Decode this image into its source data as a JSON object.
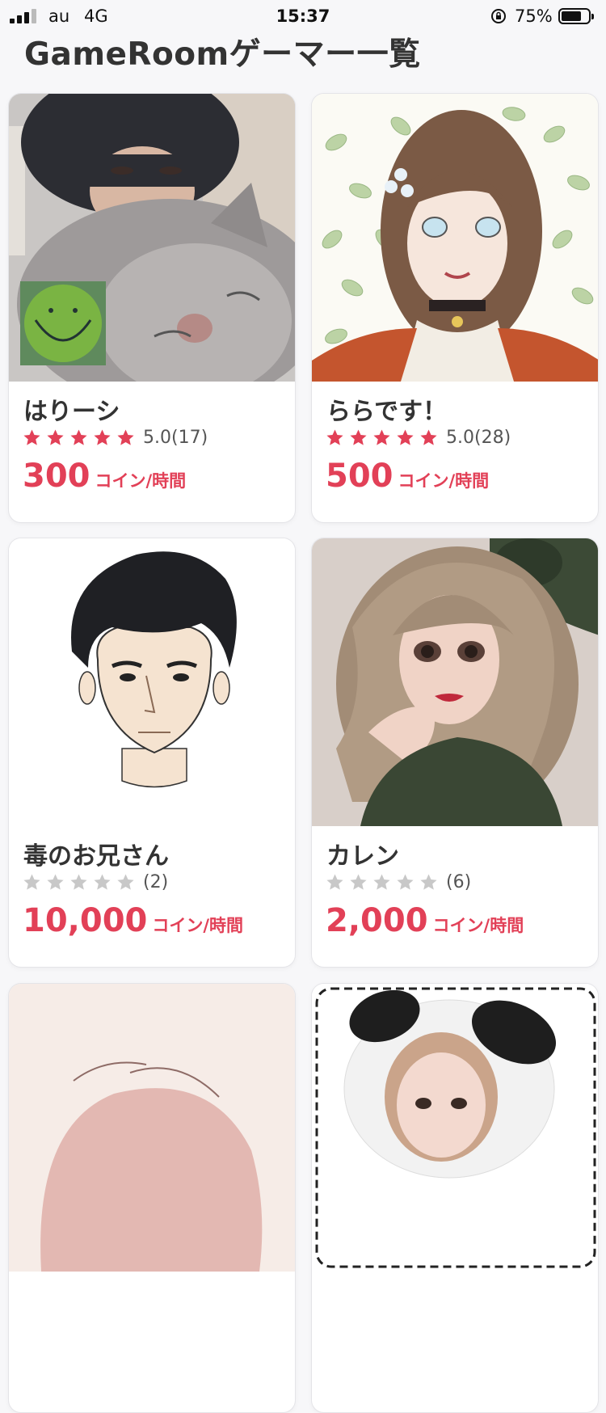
{
  "status_bar": {
    "carrier": "au",
    "network": "4G",
    "time": "15:37",
    "battery_percent": "75%",
    "battery_level": 0.75,
    "signal_bars_filled": 3,
    "signal_bars_total": 4
  },
  "header": {
    "title": "GameRoomゲーマー一覧"
  },
  "colors": {
    "accent": "#e24057",
    "star_filled": "#e24057",
    "star_empty": "#c8c8c8",
    "background": "#f7f7f9"
  },
  "gamers": [
    {
      "name": "はりーシ",
      "rating": 5,
      "rating_text": "5.0(17)",
      "price": "300",
      "unit": "コイン/時間",
      "photo": "man-with-grey-cat-photo"
    },
    {
      "name": "ららです！",
      "rating": 5,
      "rating_text": "5.0(28)",
      "price": "500",
      "unit": "コイン/時間",
      "photo": "illustrated-girl-with-leaves-avatar"
    },
    {
      "name": "毒のお兄さん",
      "rating": 0,
      "rating_text": "(2)",
      "price": "10,000",
      "unit": "コイン/時間",
      "photo": "illustrated-man-avatar"
    },
    {
      "name": "カレン",
      "rating": 0,
      "rating_text": "(6)",
      "price": "2,000",
      "unit": "コイン/時間",
      "photo": "woman-long-curly-hair-photo"
    },
    {
      "name": "",
      "rating": 0,
      "rating_text": "",
      "price": "",
      "unit": "",
      "photo": "illustrated-pink-hair-avatar"
    },
    {
      "name": "",
      "rating": 0,
      "rating_text": "",
      "price": "",
      "unit": "",
      "photo": "woman-panda-hood-photo"
    }
  ]
}
